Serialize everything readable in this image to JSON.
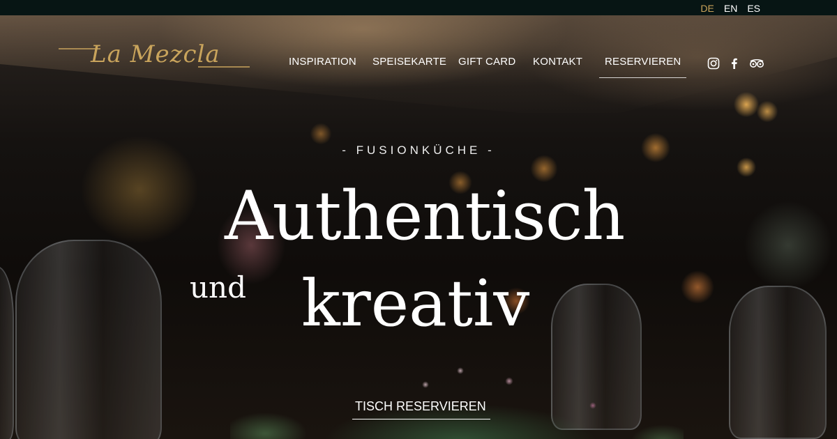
{
  "languages": [
    {
      "code": "DE",
      "active": true
    },
    {
      "code": "EN",
      "active": false
    },
    {
      "code": "ES",
      "active": false
    }
  ],
  "header": {
    "logo_text": "La Mezcla",
    "nav": [
      {
        "label": "INSPIRATION"
      },
      {
        "label": "SPEISEKARTE"
      },
      {
        "label": "GIFT CARD"
      },
      {
        "label": "KONTAKT"
      },
      {
        "label": "RESERVIEREN",
        "active": true
      }
    ],
    "social_icons": [
      "instagram-icon",
      "facebook-icon",
      "tripadvisor-icon"
    ]
  },
  "hero": {
    "kicker": "- FUSIONKÜCHE -",
    "headline_line1": "Authentisch",
    "headline_small": "und",
    "headline_line2": "kreativ",
    "cta_label": "TISCH RESERVIEREN"
  },
  "colors": {
    "accent_gold": "#c9a45c",
    "language_active": "#c8a35a",
    "topbar_bg": "#071514"
  }
}
